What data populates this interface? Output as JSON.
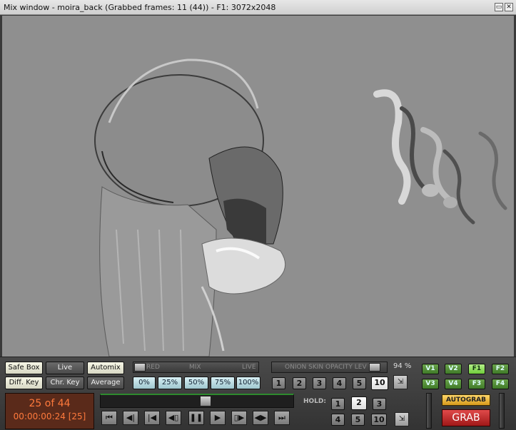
{
  "window": {
    "title": "Mix window - moira_back (Grabbed frames: 11 (44)) - F1: 3072x2048",
    "restore_icon": "restore-icon",
    "close_icon": "close-icon"
  },
  "viewport": {
    "description_icon": "frame-preview"
  },
  "key_buttons": {
    "safe_box": "Safe Box",
    "live": "Live",
    "automix": "Automix",
    "diff_key": "Diff. Key",
    "chr_key": "Chr. Key",
    "average": "Average"
  },
  "mix_slider": {
    "left_label": "RED",
    "center_label": "MIX",
    "right_label": "LIVE",
    "presets": [
      "0%",
      "25%",
      "50%",
      "75%",
      "100%"
    ]
  },
  "onion_skin": {
    "label": "ONION SKIN OPACITY LEV",
    "value": "94 %",
    "level": 0.94,
    "numbers": [
      "1",
      "2",
      "3",
      "4",
      "5",
      "10"
    ],
    "selected": "10"
  },
  "views": {
    "row1": [
      "V1",
      "V2",
      "F1",
      "F2"
    ],
    "row2": [
      "V3",
      "V4",
      "F3",
      "F4"
    ],
    "selected": [
      "F1"
    ]
  },
  "counter": {
    "frame": "25 of 44",
    "timecode": "00:00:00:24 [25]"
  },
  "timeline": {
    "position": 0.55
  },
  "transport": [
    "go-start-icon",
    "step-back-icon",
    "play-reverse-icon",
    "loop-back-icon",
    "pause-icon",
    "play-icon",
    "loop-forward-icon",
    "ping-pong-icon",
    "go-end-icon"
  ],
  "hold": {
    "label": "HOLD:",
    "row1": [
      "1",
      "2",
      "3"
    ],
    "row2": [
      "4",
      "5",
      "10"
    ],
    "selected": "2"
  },
  "grab": {
    "autograb": "AUTOGRAB",
    "grab": "GRAB"
  }
}
